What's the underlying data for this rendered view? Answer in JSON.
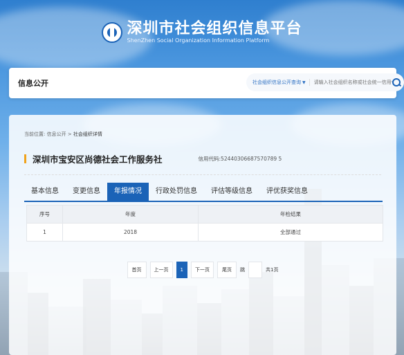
{
  "site": {
    "title": "深圳市社会组织信息平台",
    "subtitle": "ShenZhen Social Organization Information Platform"
  },
  "topbar": {
    "label": "信息公开",
    "search_scope": "社会组织信息公开查询",
    "search_placeholder": "请输入社会组织名称或社会统一信用代码"
  },
  "breadcrumb": {
    "prefix": "当前位置:",
    "home": "信息公开",
    "sep": ">",
    "current": "社会组织详情"
  },
  "org": {
    "name": "深圳市宝安区尚德社会工作服务社",
    "credit_code": "信用代码:52440306687570789 5"
  },
  "tabs": [
    {
      "label": "基本信息",
      "active": false
    },
    {
      "label": "变更信息",
      "active": false
    },
    {
      "label": "年报情况",
      "active": true
    },
    {
      "label": "行政处罚信息",
      "active": false
    },
    {
      "label": "评估等级信息",
      "active": false
    },
    {
      "label": "评优获奖信息",
      "active": false
    }
  ],
  "table": {
    "headers": [
      "序号",
      "年度",
      "年检结果"
    ],
    "rows": [
      [
        "1",
        "2018",
        "全部通过"
      ]
    ]
  },
  "pager": {
    "first": "首页",
    "prev": "上一页",
    "current": "1",
    "next": "下一页",
    "last": "尾页",
    "jump": "跳",
    "total": "共1页"
  },
  "colors": {
    "accent": "#1b63b7",
    "marker": "#f0a21b"
  }
}
